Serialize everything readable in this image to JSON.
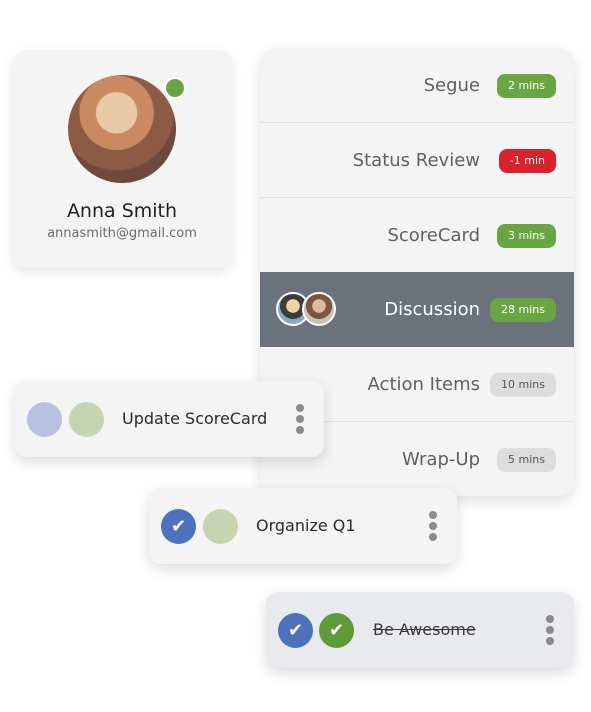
{
  "profile": {
    "name": "Anna Smith",
    "email": "annasmith@gmail.com",
    "status_color": "#6aa544"
  },
  "agenda": {
    "items": [
      {
        "label": "Segue",
        "duration": "2 mins",
        "badge_color": "green"
      },
      {
        "label": "Status Review",
        "duration": "-1 min",
        "badge_color": "red"
      },
      {
        "label": "ScoreCard",
        "duration": "3 mins",
        "badge_color": "green"
      },
      {
        "label": "Discussion",
        "duration": "28 mins",
        "badge_color": "green",
        "active": true
      },
      {
        "label": "Action Items",
        "duration": "10 mins",
        "badge_color": "gray"
      },
      {
        "label": "Wrap-Up",
        "duration": "5 mins",
        "badge_color": "gray"
      }
    ]
  },
  "tasks": [
    {
      "title": "Update ScoreCard",
      "completed": false,
      "icons": [
        "circle-blue-light",
        "circle-green-light"
      ]
    },
    {
      "title": "Organize Q1",
      "completed": false,
      "icons": [
        "check-icon",
        "circle-green-light"
      ]
    },
    {
      "title": "Be Awesome",
      "completed": true,
      "icons": [
        "check-icon",
        "check-icon"
      ]
    }
  ],
  "icons": {
    "check": "✔",
    "more": "more-vertical-icon"
  },
  "colors": {
    "green": "#6aa544",
    "red": "#d8222e",
    "active_row": "#6b727c",
    "blue": "#4d72bb"
  }
}
